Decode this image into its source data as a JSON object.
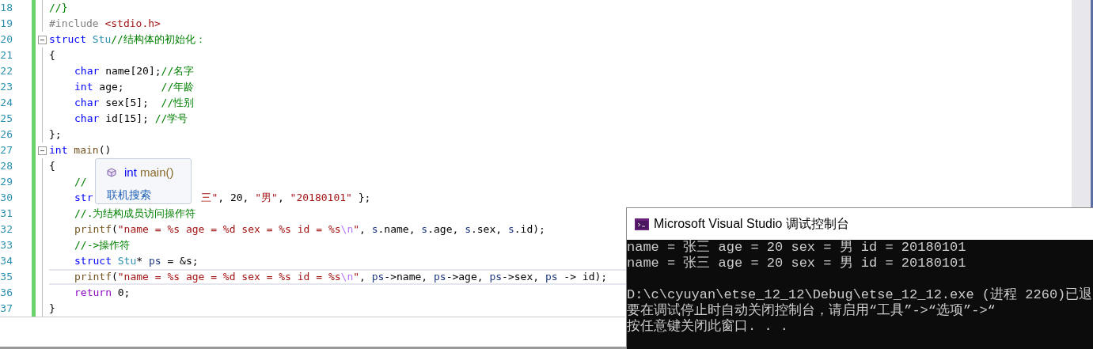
{
  "editor": {
    "lines": [
      {
        "number": "18",
        "tokens": [
          {
            "text": "//}",
            "kind": "comment"
          }
        ]
      },
      {
        "number": "19",
        "tokens": [
          {
            "text": "#include ",
            "kind": "preproc"
          },
          {
            "text": "<stdio.h>",
            "kind": "string"
          }
        ]
      },
      {
        "number": "20",
        "fold": true,
        "tokens": [
          {
            "text": "struct ",
            "kind": "keyword"
          },
          {
            "text": "Stu",
            "kind": "type"
          },
          {
            "text": "//结构体的初始化：",
            "kind": "comment"
          }
        ]
      },
      {
        "number": "21",
        "tokens": [
          {
            "text": "{",
            "kind": "plain"
          }
        ],
        "children": [
          {
            "number": "22",
            "tokens": [
              {
                "text": "char ",
                "kind": "keyword"
              },
              {
                "text": "name[20];",
                "kind": "plain"
              },
              {
                "text": "//名字",
                "kind": "comment"
              }
            ]
          },
          {
            "number": "23",
            "tokens": [
              {
                "text": "int ",
                "kind": "keyword"
              },
              {
                "text": "age;      ",
                "kind": "plain"
              },
              {
                "text": "//年龄",
                "kind": "comment"
              }
            ]
          },
          {
            "number": "24",
            "tokens": [
              {
                "text": "char ",
                "kind": "keyword"
              },
              {
                "text": "sex[5];  ",
                "kind": "plain"
              },
              {
                "text": "//性别",
                "kind": "comment"
              }
            ]
          },
          {
            "number": "25",
            "tokens": [
              {
                "text": "char ",
                "kind": "keyword"
              },
              {
                "text": "id[15]; ",
                "kind": "plain"
              },
              {
                "text": "//学号",
                "kind": "comment"
              }
            ]
          }
        ]
      },
      {
        "number": "26",
        "tokens": [
          {
            "text": "};",
            "kind": "plain"
          }
        ]
      },
      {
        "number": "27",
        "fold": true,
        "tokens": [
          {
            "text": "int ",
            "kind": "keyword"
          },
          {
            "text": "main",
            "kind": "function"
          },
          {
            "text": "()",
            "kind": "plain"
          }
        ]
      },
      {
        "number": "28",
        "tokens": [
          {
            "text": "{",
            "kind": "plain"
          }
        ],
        "children": [
          {
            "number": "29",
            "tokens": [
              {
                "text": "//",
                "kind": "comment"
              }
            ]
          },
          {
            "number": "30",
            "tokens": [
              {
                "text": "str",
                "kind": "keyword"
              },
              {
                "text": "三\"",
                "kind": "string",
                "covered_before": true
              },
              {
                "text": ", 20, ",
                "kind": "plain"
              },
              {
                "text": "\"男\"",
                "kind": "string"
              },
              {
                "text": ", ",
                "kind": "plain"
              },
              {
                "text": "\"20180101\"",
                "kind": "string"
              },
              {
                "text": " };",
                "kind": "plain"
              }
            ]
          },
          {
            "number": "31",
            "tokens": [
              {
                "text": "//.为结构成员访问操作符",
                "kind": "comment"
              }
            ]
          },
          {
            "number": "32",
            "tokens": [
              {
                "text": "printf",
                "kind": "function"
              },
              {
                "text": "(",
                "kind": "plain"
              },
              {
                "text": "\"name = %s age = %d sex = %s id = %s",
                "kind": "string"
              },
              {
                "text": "\\n",
                "kind": "escape"
              },
              {
                "text": "\"",
                "kind": "string"
              },
              {
                "text": ", ",
                "kind": "plain"
              },
              {
                "text": "s",
                "kind": "variable"
              },
              {
                "text": ".name, ",
                "kind": "plain"
              },
              {
                "text": "s",
                "kind": "variable"
              },
              {
                "text": ".age, ",
                "kind": "plain"
              },
              {
                "text": "s",
                "kind": "variable"
              },
              {
                "text": ".sex, ",
                "kind": "plain"
              },
              {
                "text": "s",
                "kind": "variable"
              },
              {
                "text": ".id);",
                "kind": "plain"
              }
            ]
          },
          {
            "number": "33",
            "tokens": [
              {
                "text": "//->操作符",
                "kind": "comment"
              }
            ]
          },
          {
            "number": "34",
            "tokens": [
              {
                "text": "struct ",
                "kind": "keyword"
              },
              {
                "text": "Stu",
                "kind": "type"
              },
              {
                "text": "* ",
                "kind": "plain"
              },
              {
                "text": "ps",
                "kind": "variable"
              },
              {
                "text": " = &s;",
                "kind": "plain"
              }
            ]
          },
          {
            "number": "35",
            "current": true,
            "tokens": [
              {
                "text": "printf",
                "kind": "function"
              },
              {
                "text": "(",
                "kind": "plain"
              },
              {
                "text": "\"name = %s age = %d sex = %s id = %s",
                "kind": "string"
              },
              {
                "text": "\\n",
                "kind": "escape"
              },
              {
                "text": "\"",
                "kind": "string"
              },
              {
                "text": ", ",
                "kind": "plain"
              },
              {
                "text": "ps",
                "kind": "variable"
              },
              {
                "text": "->name, ",
                "kind": "plain"
              },
              {
                "text": "ps",
                "kind": "variable"
              },
              {
                "text": "->age, ",
                "kind": "plain"
              },
              {
                "text": "ps",
                "kind": "variable"
              },
              {
                "text": "->sex, ",
                "kind": "plain"
              },
              {
                "text": "ps",
                "kind": "variable"
              },
              {
                "text": " -> id);",
                "kind": "plain"
              }
            ]
          },
          {
            "number": "36",
            "tokens": [
              {
                "text": "return ",
                "kind": "control"
              },
              {
                "text": "0;",
                "kind": "plain"
              }
            ]
          }
        ]
      },
      {
        "number": "37",
        "tokens": [
          {
            "text": "}",
            "kind": "plain"
          }
        ]
      }
    ]
  },
  "tooltip": {
    "signature": [
      {
        "text": "int ",
        "kind": "keyword"
      },
      {
        "text": "main()",
        "kind": "function"
      }
    ],
    "link": "联机搜索"
  },
  "console": {
    "title": "Microsoft Visual Studio 调试控制台",
    "lines": [
      "name = 张三 age = 20 sex = 男 id = 20180101",
      "name = 张三 age = 20 sex = 男 id = 20180101",
      "D:\\c\\cyuyan\\etse_12_12\\Debug\\etse_12_12.exe (进程 2260)已退",
      "要在调试停止时自动关闭控制台，请启用“工具”->“选项”->“",
      "按任意键关闭此窗口. . ."
    ]
  }
}
